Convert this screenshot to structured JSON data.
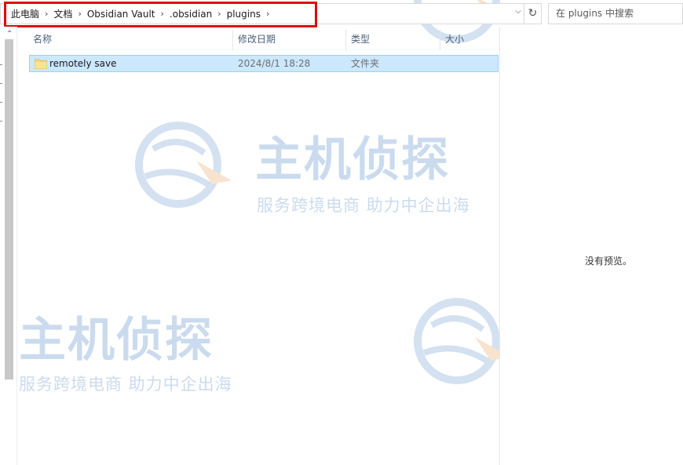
{
  "address_bar": {
    "crumbs": [
      "此电脑",
      "文档",
      "Obsidian Vault",
      ".obsidian",
      "plugins"
    ]
  },
  "search": {
    "placeholder": "在 plugins 中搜索"
  },
  "columns": {
    "name": "名称",
    "date": "修改日期",
    "type": "类型",
    "size": "大小"
  },
  "files": [
    {
      "name": "remotely save",
      "modified": "2024/8/1 18:28",
      "type": "文件夹",
      "icon": "folder-icon"
    }
  ],
  "preview": {
    "empty_text": "没有预览。"
  },
  "watermark": {
    "brand": "主机侦探",
    "slogan": "服务跨境电商 助力中企出海"
  },
  "colors": {
    "selection": "#cce8ff",
    "highlight_box": "#e10a0a",
    "watermark": "#a9c4e4",
    "folder": "#f8d775"
  }
}
